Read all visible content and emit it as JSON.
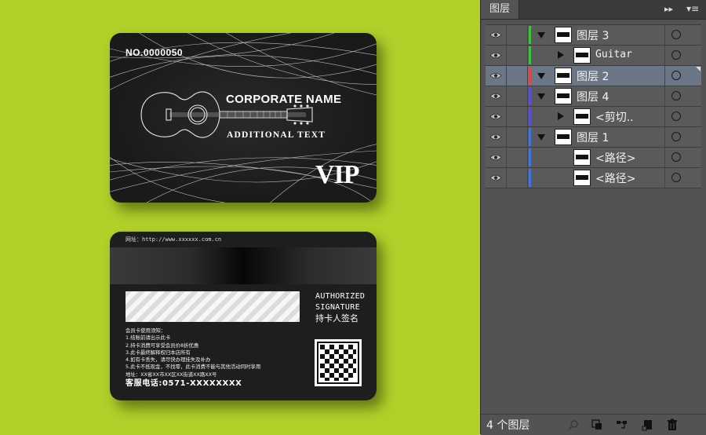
{
  "front_card": {
    "card_number": "NO.0000050",
    "corporate_name": "CORPORATE NAME",
    "additional_text": "ADDITIONAL TEXT",
    "vip_label": "VIP"
  },
  "back_card": {
    "website": "网址：http://www.xxxxxx.com.cn",
    "auth_line1": "AUTHORIZED",
    "auth_line2": "SIGNATURE",
    "auth_line3": "持卡人签名",
    "rules": [
      "会员卡使用须知：",
      "1.结账前请出示此卡",
      "2.持卡消费可享受会员价8折优惠",
      "3.此卡最终解释权归本店所有",
      "4.如有卡丢失，请尽快办理挂失及补办",
      "5.此卡不抵现金，不找零，此卡消费不能与其他活动同时享用",
      "地址：XX省XX市XX区XX街道XX路XX号"
    ],
    "hotline": "客服电话:0571-XXXXXXXX"
  },
  "layers_panel": {
    "tab_label": "图层",
    "collapse_icon": "double-chevron-right-icon",
    "menu_icon": "panel-menu-icon",
    "layers": [
      {
        "name": "图层 3",
        "color": "#3bc43b",
        "indent": 0,
        "expander": "down",
        "mono": false,
        "selected": false
      },
      {
        "name": "Guitar",
        "color": "#3bc43b",
        "indent": 1,
        "expander": "right",
        "mono": true,
        "selected": false
      },
      {
        "name": "图层 2",
        "color": "#e04848",
        "indent": 0,
        "expander": "down",
        "mono": false,
        "selected": true
      },
      {
        "name": "图层 4",
        "color": "#5a4fe0",
        "indent": 0,
        "expander": "down",
        "mono": false,
        "selected": false
      },
      {
        "name": "<剪切..",
        "color": "#5a4fe0",
        "indent": 1,
        "expander": "right",
        "mono": false,
        "selected": false
      },
      {
        "name": "图层 1",
        "color": "#3e74e0",
        "indent": 0,
        "expander": "down",
        "mono": false,
        "selected": false
      },
      {
        "name": "<路径>",
        "color": "#3e74e0",
        "indent": 1,
        "expander": "none",
        "mono": false,
        "selected": false
      },
      {
        "name": "<路径>",
        "color": "#3e74e0",
        "indent": 1,
        "expander": "none",
        "mono": false,
        "selected": false
      }
    ],
    "layer_count": "4 个图层",
    "footer_icons": [
      "locate-object-icon",
      "make-clipping-mask-icon",
      "new-sublayer-icon",
      "new-layer-icon",
      "trash-icon"
    ]
  }
}
